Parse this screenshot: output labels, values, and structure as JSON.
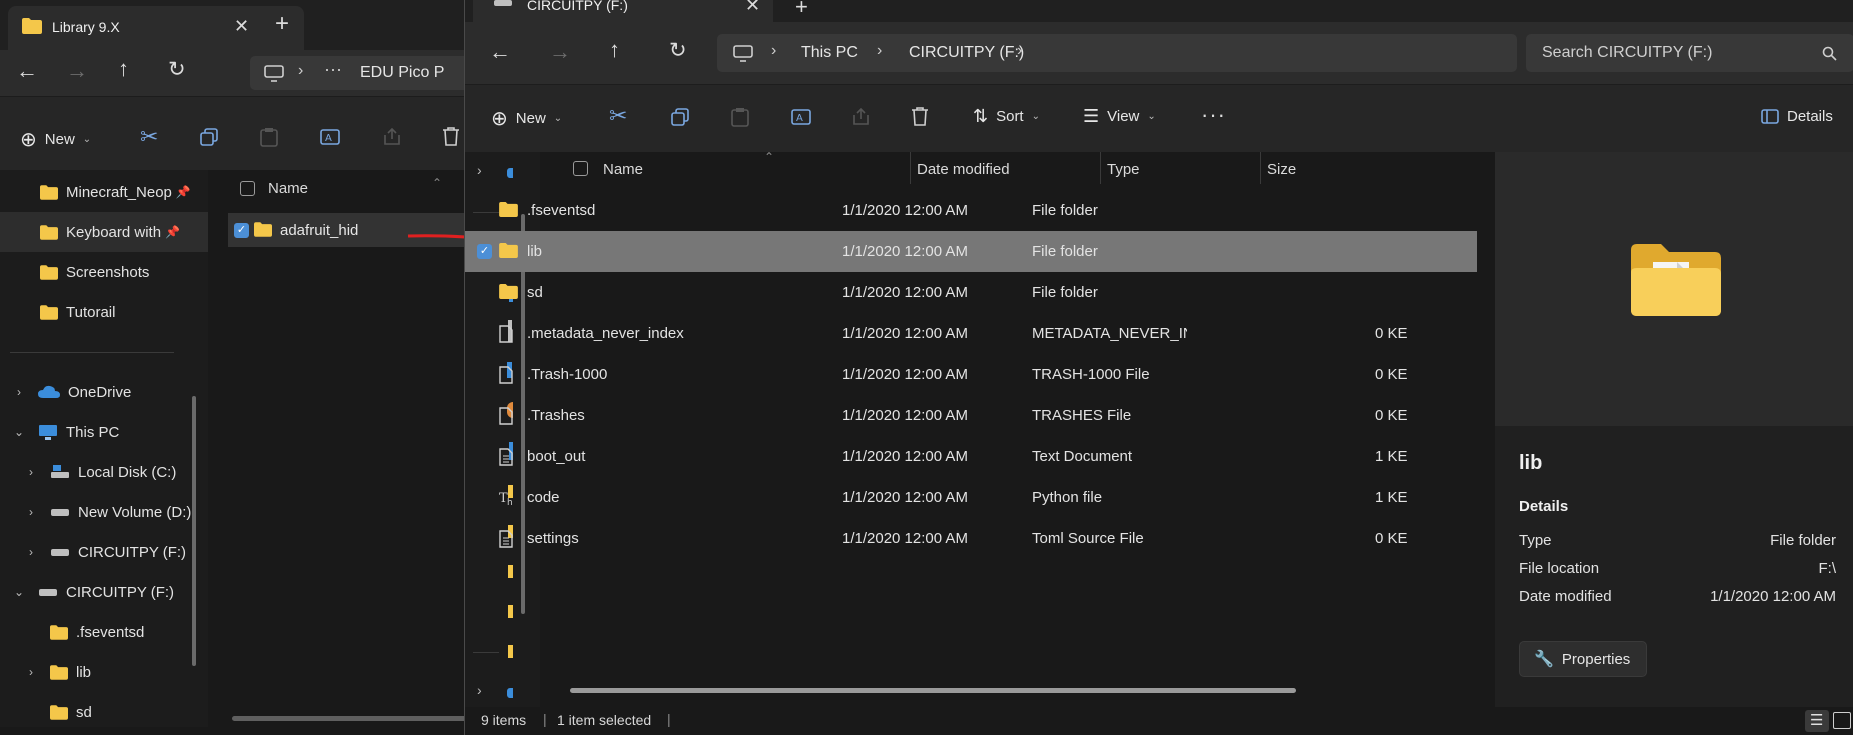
{
  "back_window": {
    "tab_title": "Library 9.X",
    "address_tail": "EDU Pico P",
    "new_label": "New",
    "column_name": "Name",
    "nav_items": [
      {
        "label": "Minecraft_Neop",
        "pinned": true
      },
      {
        "label": "Keyboard with",
        "pinned": true
      },
      {
        "label": "Screenshots",
        "pinned": false
      },
      {
        "label": "Tutorail",
        "pinned": false
      }
    ],
    "tree": [
      {
        "label": "OneDrive",
        "icon": "cloud-icon"
      },
      {
        "label": "This PC",
        "icon": "pc-icon"
      },
      {
        "label": "Local Disk (C:)",
        "icon": "drive-icon"
      },
      {
        "label": "New Volume (D:)",
        "icon": "drive-icon"
      },
      {
        "label": "CIRCUITPY (F:)",
        "icon": "drive-icon"
      },
      {
        "label": "CIRCUITPY (F:)",
        "icon": "drive-icon"
      },
      {
        "label": ".fseventsd",
        "icon": "folder-icon"
      },
      {
        "label": "lib",
        "icon": "folder-icon"
      },
      {
        "label": "sd",
        "icon": "folder-icon"
      }
    ],
    "selected_file": "adafruit_hid"
  },
  "front_window": {
    "tab_title": "CIRCUITPY (F:)",
    "breadcrumb": [
      "This PC",
      "CIRCUITPY (F:)"
    ],
    "search_placeholder": "Search CIRCUITPY (F:)",
    "toolbar": {
      "new_label": "New",
      "sort_label": "Sort",
      "view_label": "View",
      "details_label": "Details"
    },
    "columns": {
      "name": "Name",
      "date": "Date modified",
      "type": "Type",
      "size": "Size"
    },
    "files": [
      {
        "name": ".fseventsd",
        "date": "1/1/2020 12:00 AM",
        "type": "File folder",
        "size": "",
        "icon": "folder-icon",
        "selected": false
      },
      {
        "name": "lib",
        "date": "1/1/2020 12:00 AM",
        "type": "File folder",
        "size": "",
        "icon": "folder-icon",
        "selected": true
      },
      {
        "name": "sd",
        "date": "1/1/2020 12:00 AM",
        "type": "File folder",
        "size": "",
        "icon": "folder-icon",
        "selected": false
      },
      {
        "name": ".metadata_never_index",
        "date": "1/1/2020 12:00 AM",
        "type": "METADATA_NEVER_IND...",
        "size": "0 KE",
        "icon": "file-icon",
        "selected": false
      },
      {
        "name": ".Trash-1000",
        "date": "1/1/2020 12:00 AM",
        "type": "TRASH-1000 File",
        "size": "0 KE",
        "icon": "file-icon",
        "selected": false
      },
      {
        "name": ".Trashes",
        "date": "1/1/2020 12:00 AM",
        "type": "TRASHES File",
        "size": "0 KE",
        "icon": "file-icon",
        "selected": false
      },
      {
        "name": "boot_out",
        "date": "1/1/2020 12:00 AM",
        "type": "Text Document",
        "size": "1 KE",
        "icon": "text-file-icon",
        "selected": false
      },
      {
        "name": "code",
        "date": "1/1/2020 12:00 AM",
        "type": "Python file",
        "size": "1 KE",
        "icon": "python-file-icon",
        "selected": false
      },
      {
        "name": "settings",
        "date": "1/1/2020 12:00 AM",
        "type": "Toml Source File",
        "size": "0 KE",
        "icon": "text-file-icon",
        "selected": false
      }
    ],
    "details_pane": {
      "title": "lib",
      "section": "Details",
      "props": [
        {
          "key": "Type",
          "value": "File folder"
        },
        {
          "key": "File location",
          "value": "F:\\"
        },
        {
          "key": "Date modified",
          "value": "1/1/2020 12:00 AM"
        }
      ],
      "properties_button": "Properties"
    },
    "status": {
      "items": "9 items",
      "selected": "1 item selected"
    }
  },
  "colors": {
    "accent": "#4c8fd6",
    "folder": "#f4c74a",
    "arrow": "#e02020",
    "selection": "#777777"
  }
}
